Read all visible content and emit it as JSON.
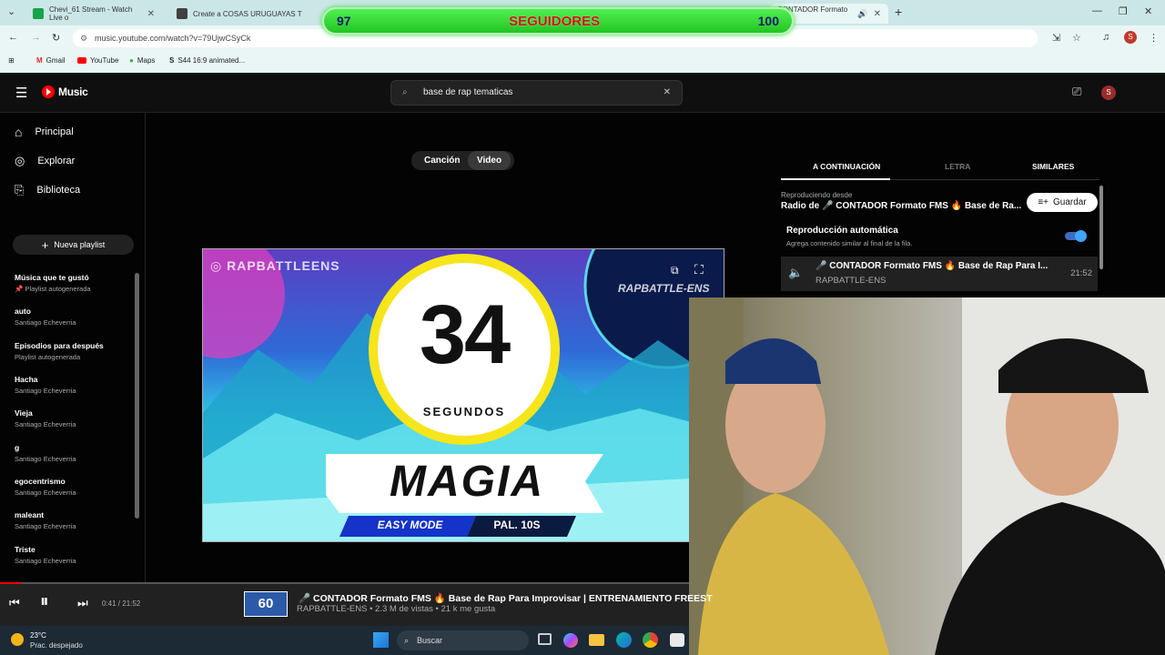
{
  "browser": {
    "tabs": [
      {
        "title": "Chevi_61 Stream - Watch Live o",
        "color": "#16a34a"
      },
      {
        "title": "Create a COSAS URUGUAYAS T",
        "color": "#404040"
      },
      {
        "title": "CONTADOR Formato FI",
        "color": "#e00000"
      }
    ],
    "url": "music.youtube.com/watch?v=79UjwCSyCk",
    "bookmarks": [
      "Gmail",
      "YouTube",
      "Maps",
      "S44 16:9 animated..."
    ],
    "profile_initial": "S"
  },
  "followers": {
    "left": "97",
    "title": "SEGUIDORES",
    "right": "100"
  },
  "ytmusic": {
    "logo": "Music",
    "search_value": "base de rap tematicas",
    "avatar": "S"
  },
  "sidebar": {
    "nav": [
      {
        "label": "Principal",
        "icon": "home-icon"
      },
      {
        "label": "Explorar",
        "icon": "explore-icon"
      },
      {
        "label": "Biblioteca",
        "icon": "library-icon"
      }
    ],
    "new_playlist": "Nueva playlist",
    "playlists": [
      {
        "title": "Música que te gustó",
        "sub": "Playlist autogenerada"
      },
      {
        "title": "auto",
        "sub": "Santiago Echeverria"
      },
      {
        "title": "Episodios para después",
        "sub": "Playlist autogenerada"
      },
      {
        "title": "Hacha",
        "sub": "Santiago Echeverria"
      },
      {
        "title": "Vieja",
        "sub": "Santiago Echeverria"
      },
      {
        "title": "g",
        "sub": "Santiago Echeverria"
      },
      {
        "title": "egocentrismo",
        "sub": "Santiago Echeverria"
      },
      {
        "title": "maleant",
        "sub": "Santiago Echeverria"
      },
      {
        "title": "Triste",
        "sub": "Santiago Echeverria"
      }
    ]
  },
  "toggle": {
    "song": "Canción",
    "video": "Video"
  },
  "video": {
    "watermark": "RAPBATTLEENS",
    "brand": "RAPBATTLE-ENS",
    "counter": "34",
    "counter_unit": "SEGUNDOS",
    "word": "MAGIA",
    "mode": "EASY MODE",
    "pal": "PAL. 10S"
  },
  "queue": {
    "tabs": [
      "A CONTINUACIÓN",
      "LETRA",
      "SIMILARES"
    ],
    "playing_from": "Reproduciendo desde",
    "radio_title": "Radio de 🎤 CONTADOR Formato FMS 🔥 Base de Ra...",
    "save": "Guardar",
    "autoplay_title": "Reproducción automática",
    "autoplay_sub": "Agrega contenido similar al final de la fila.",
    "item_title": "🎤 CONTADOR Formato FMS 🔥 Base de Rap Para I...",
    "item_artist": "RAPBATTLE-ENS",
    "item_duration": "21:52"
  },
  "player": {
    "time": "0:41 / 21:52",
    "progress": 0.031,
    "thumb_text": "60",
    "title": "🎤 CONTADOR Formato FMS 🔥 Base de Rap Para Improvisar | ENTRENAMIENTO FREEST",
    "meta": "RAPBATTLE-ENS • 2.3 M de vistas • 21 k me gusta"
  },
  "taskbar": {
    "temp": "23°C",
    "weather": "Prac. despejado",
    "search": "Buscar"
  }
}
